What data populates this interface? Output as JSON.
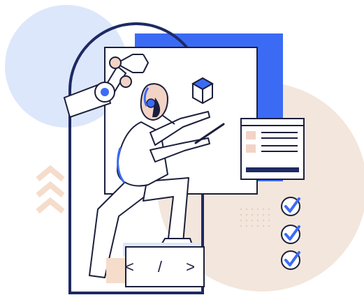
{
  "illustration": {
    "colors": {
      "accent_blue": "#3B6BF5",
      "light_blue_circle": "#DDE7FB",
      "peach": "#F3E6DC",
      "peach_dark": "#E8CDB8",
      "ink": "#1B1F3B",
      "navy": "#1E2A63",
      "figure_fill": "#FFFFFF",
      "robot_joint": "#F2D3C6",
      "chevron_peach": "#F5DCCB"
    },
    "code_symbol": "< / >",
    "checklist": {
      "checked_items": 3,
      "icon": "checkmark-circle-icon"
    },
    "document": {
      "lines": 5,
      "icon": "document-icon"
    },
    "floating_cube": {
      "icon": "cube-icon"
    },
    "chevrons": {
      "count": 3,
      "icon": "chevron-up-icon"
    }
  }
}
